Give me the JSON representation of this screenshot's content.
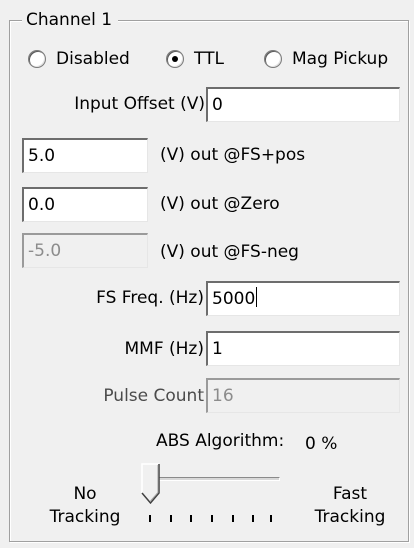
{
  "group": {
    "title": "Channel 1"
  },
  "mode": {
    "options": [
      "Disabled",
      "TTL",
      "Mag Pickup"
    ],
    "selected": "TTL"
  },
  "input_offset": {
    "label": "Input Offset (V)",
    "value": "0"
  },
  "fs_pos": {
    "value": "5.0",
    "label": "(V) out @FS+pos"
  },
  "zero": {
    "value": "0.0",
    "label": "(V) out @Zero"
  },
  "fs_neg": {
    "value": "-5.0",
    "label": "(V) out @FS-neg",
    "disabled": true
  },
  "fs_freq": {
    "label": "FS Freq. (Hz)",
    "value": "5000"
  },
  "mmf": {
    "label": "MMF (Hz)",
    "value": "1"
  },
  "pulse_count": {
    "label": "Pulse Count",
    "value": "16",
    "disabled": true
  },
  "abs": {
    "label": "ABS Algorithm:",
    "value": "0 %",
    "left_label_1": "No",
    "left_label_2": "Tracking",
    "right_label_1": "Fast",
    "right_label_2": "Tracking",
    "slider_level": 0
  }
}
